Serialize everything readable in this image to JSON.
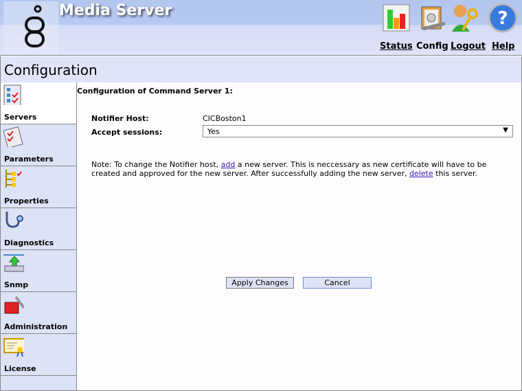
{
  "header": {
    "title": "Media Server",
    "nav": [
      {
        "label": "Status",
        "icon": "status-chart-icon"
      },
      {
        "label": "Config",
        "icon": "config-clipboard-icon"
      },
      {
        "label": "Logout",
        "icon": "logout-user-key-icon"
      },
      {
        "label": "Help",
        "icon": "help-question-icon"
      }
    ]
  },
  "page": {
    "title": "Configuration"
  },
  "sidebar": {
    "items": [
      {
        "label": "Servers"
      },
      {
        "label": "Parameters"
      },
      {
        "label": "Properties"
      },
      {
        "label": "Diagnostics"
      },
      {
        "label": "Snmp"
      },
      {
        "label": "Administration"
      },
      {
        "label": "License"
      }
    ]
  },
  "main": {
    "heading": "Configuration of Command Server 1:",
    "notifier_label": "Notifier Host:",
    "notifier_value": "CICBoston1",
    "accept_label": "Accept sessions:",
    "accept_value": "Yes",
    "note1": "Note: To change the Notifier host, ",
    "note_add": "add",
    "note2": " a new server. This is neccessary as new certificate will have to be created and approved for the new server. After successfully adding the new server, ",
    "note_delete": "delete",
    "note3": " this server.",
    "apply": "Apply Changes",
    "cancel": "Cancel"
  }
}
